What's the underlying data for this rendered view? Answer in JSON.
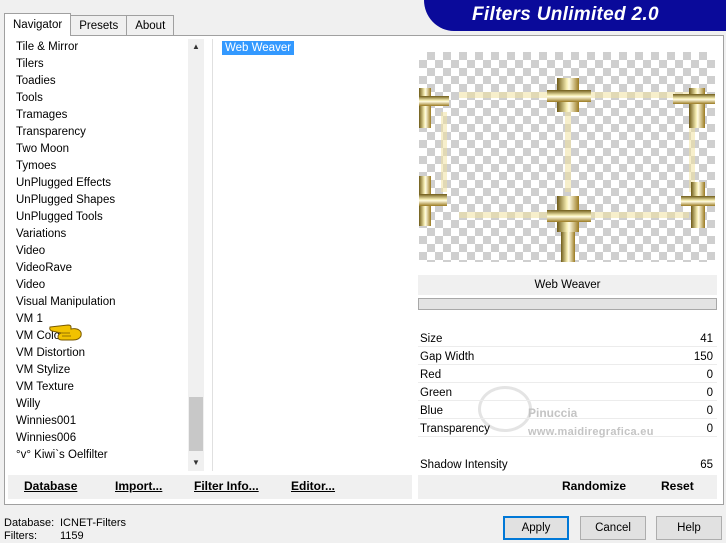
{
  "tabs": [
    "Navigator",
    "Presets",
    "About"
  ],
  "banner_title": "Filters Unlimited 2.0",
  "categories": [
    "Tile & Mirror",
    "Tilers",
    "Toadies",
    "Tools",
    "Tramages",
    "Transparency",
    "Two Moon",
    "Tymoes",
    "UnPlugged Effects",
    "UnPlugged Shapes",
    "UnPlugged Tools",
    "Variations",
    "Video",
    "VideoRave",
    "Video",
    "Visual Manipulation",
    "VM 1",
    "VM Colorize",
    "VM Distortion",
    "VM Stylize",
    "VM Texture",
    "Willy",
    "Winnies001",
    "Winnies006",
    "°v° Kiwi`s Oelfilter"
  ],
  "selected_filter": "Web Weaver",
  "filter_name": "Web Weaver",
  "params": [
    {
      "label": "Size",
      "value": "41"
    },
    {
      "label": "Gap Width",
      "value": "150"
    },
    {
      "label": "Red",
      "value": "0"
    },
    {
      "label": "Green",
      "value": "0"
    },
    {
      "label": "Blue",
      "value": "0"
    },
    {
      "label": "Transparency",
      "value": "0"
    }
  ],
  "shadow": {
    "label": "Shadow Intensity",
    "value": "65"
  },
  "left_buttons": {
    "database": "Database",
    "import": "Import...",
    "filter_info": "Filter Info...",
    "editor": "Editor..."
  },
  "right_buttons": {
    "randomize": "Randomize",
    "reset": "Reset"
  },
  "status": {
    "database_label": "Database:",
    "database_value": "ICNET-Filters",
    "filters_label": "Filters:",
    "filters_value": "1159"
  },
  "dialog_buttons": {
    "apply": "Apply",
    "cancel": "Cancel",
    "help": "Help"
  },
  "watermark": {
    "line1": "Pinuccia",
    "line2": "www.maidiregrafica.eu"
  },
  "colors": {
    "banner": "#0a0a9a",
    "selection": "#3399ff",
    "focus": "#0078d7"
  }
}
